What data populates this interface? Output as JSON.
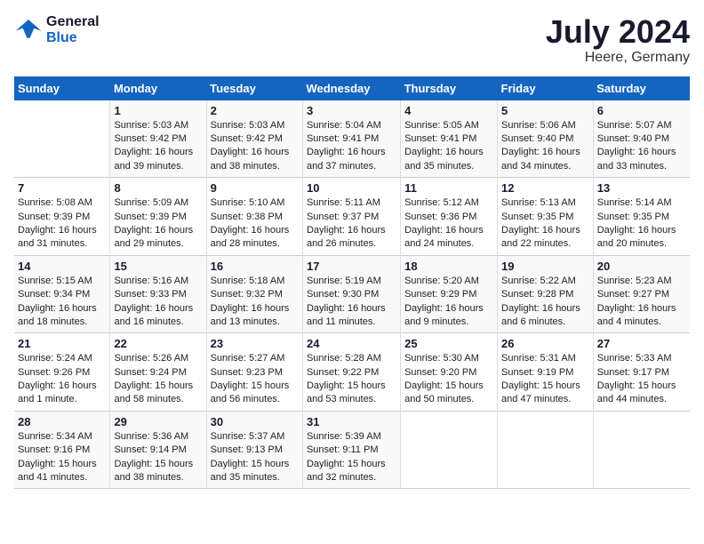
{
  "header": {
    "logo_line1": "General",
    "logo_line2": "Blue",
    "month": "July 2024",
    "location": "Heere, Germany"
  },
  "days_of_week": [
    "Sunday",
    "Monday",
    "Tuesday",
    "Wednesday",
    "Thursday",
    "Friday",
    "Saturday"
  ],
  "weeks": [
    [
      {
        "num": "",
        "info": ""
      },
      {
        "num": "1",
        "info": "Sunrise: 5:03 AM\nSunset: 9:42 PM\nDaylight: 16 hours\nand 39 minutes."
      },
      {
        "num": "2",
        "info": "Sunrise: 5:03 AM\nSunset: 9:42 PM\nDaylight: 16 hours\nand 38 minutes."
      },
      {
        "num": "3",
        "info": "Sunrise: 5:04 AM\nSunset: 9:41 PM\nDaylight: 16 hours\nand 37 minutes."
      },
      {
        "num": "4",
        "info": "Sunrise: 5:05 AM\nSunset: 9:41 PM\nDaylight: 16 hours\nand 35 minutes."
      },
      {
        "num": "5",
        "info": "Sunrise: 5:06 AM\nSunset: 9:40 PM\nDaylight: 16 hours\nand 34 minutes."
      },
      {
        "num": "6",
        "info": "Sunrise: 5:07 AM\nSunset: 9:40 PM\nDaylight: 16 hours\nand 33 minutes."
      }
    ],
    [
      {
        "num": "7",
        "info": "Sunrise: 5:08 AM\nSunset: 9:39 PM\nDaylight: 16 hours\nand 31 minutes."
      },
      {
        "num": "8",
        "info": "Sunrise: 5:09 AM\nSunset: 9:39 PM\nDaylight: 16 hours\nand 29 minutes."
      },
      {
        "num": "9",
        "info": "Sunrise: 5:10 AM\nSunset: 9:38 PM\nDaylight: 16 hours\nand 28 minutes."
      },
      {
        "num": "10",
        "info": "Sunrise: 5:11 AM\nSunset: 9:37 PM\nDaylight: 16 hours\nand 26 minutes."
      },
      {
        "num": "11",
        "info": "Sunrise: 5:12 AM\nSunset: 9:36 PM\nDaylight: 16 hours\nand 24 minutes."
      },
      {
        "num": "12",
        "info": "Sunrise: 5:13 AM\nSunset: 9:35 PM\nDaylight: 16 hours\nand 22 minutes."
      },
      {
        "num": "13",
        "info": "Sunrise: 5:14 AM\nSunset: 9:35 PM\nDaylight: 16 hours\nand 20 minutes."
      }
    ],
    [
      {
        "num": "14",
        "info": "Sunrise: 5:15 AM\nSunset: 9:34 PM\nDaylight: 16 hours\nand 18 minutes."
      },
      {
        "num": "15",
        "info": "Sunrise: 5:16 AM\nSunset: 9:33 PM\nDaylight: 16 hours\nand 16 minutes."
      },
      {
        "num": "16",
        "info": "Sunrise: 5:18 AM\nSunset: 9:32 PM\nDaylight: 16 hours\nand 13 minutes."
      },
      {
        "num": "17",
        "info": "Sunrise: 5:19 AM\nSunset: 9:30 PM\nDaylight: 16 hours\nand 11 minutes."
      },
      {
        "num": "18",
        "info": "Sunrise: 5:20 AM\nSunset: 9:29 PM\nDaylight: 16 hours\nand 9 minutes."
      },
      {
        "num": "19",
        "info": "Sunrise: 5:22 AM\nSunset: 9:28 PM\nDaylight: 16 hours\nand 6 minutes."
      },
      {
        "num": "20",
        "info": "Sunrise: 5:23 AM\nSunset: 9:27 PM\nDaylight: 16 hours\nand 4 minutes."
      }
    ],
    [
      {
        "num": "21",
        "info": "Sunrise: 5:24 AM\nSunset: 9:26 PM\nDaylight: 16 hours\nand 1 minute."
      },
      {
        "num": "22",
        "info": "Sunrise: 5:26 AM\nSunset: 9:24 PM\nDaylight: 15 hours\nand 58 minutes."
      },
      {
        "num": "23",
        "info": "Sunrise: 5:27 AM\nSunset: 9:23 PM\nDaylight: 15 hours\nand 56 minutes."
      },
      {
        "num": "24",
        "info": "Sunrise: 5:28 AM\nSunset: 9:22 PM\nDaylight: 15 hours\nand 53 minutes."
      },
      {
        "num": "25",
        "info": "Sunrise: 5:30 AM\nSunset: 9:20 PM\nDaylight: 15 hours\nand 50 minutes."
      },
      {
        "num": "26",
        "info": "Sunrise: 5:31 AM\nSunset: 9:19 PM\nDaylight: 15 hours\nand 47 minutes."
      },
      {
        "num": "27",
        "info": "Sunrise: 5:33 AM\nSunset: 9:17 PM\nDaylight: 15 hours\nand 44 minutes."
      }
    ],
    [
      {
        "num": "28",
        "info": "Sunrise: 5:34 AM\nSunset: 9:16 PM\nDaylight: 15 hours\nand 41 minutes."
      },
      {
        "num": "29",
        "info": "Sunrise: 5:36 AM\nSunset: 9:14 PM\nDaylight: 15 hours\nand 38 minutes."
      },
      {
        "num": "30",
        "info": "Sunrise: 5:37 AM\nSunset: 9:13 PM\nDaylight: 15 hours\nand 35 minutes."
      },
      {
        "num": "31",
        "info": "Sunrise: 5:39 AM\nSunset: 9:11 PM\nDaylight: 15 hours\nand 32 minutes."
      },
      {
        "num": "",
        "info": ""
      },
      {
        "num": "",
        "info": ""
      },
      {
        "num": "",
        "info": ""
      }
    ]
  ]
}
